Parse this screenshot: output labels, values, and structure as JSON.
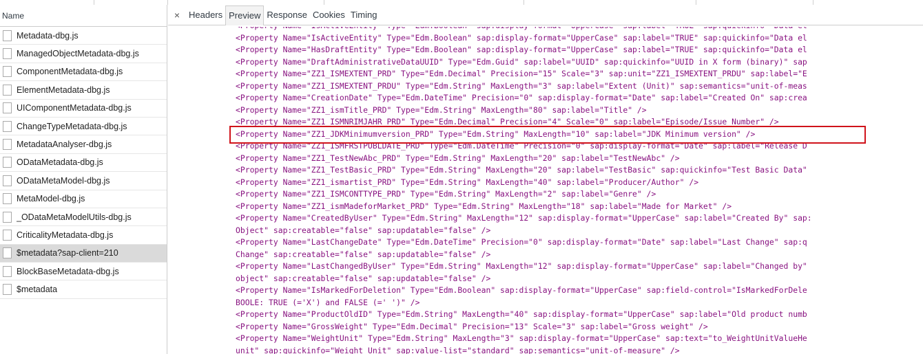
{
  "file_list": {
    "header": "Name",
    "items": [
      {
        "name": "Metadata-dbg.js",
        "selected": false
      },
      {
        "name": "ManagedObjectMetadata-dbg.js",
        "selected": false
      },
      {
        "name": "ComponentMetadata-dbg.js",
        "selected": false
      },
      {
        "name": "ElementMetadata-dbg.js",
        "selected": false
      },
      {
        "name": "UIComponentMetadata-dbg.js",
        "selected": false
      },
      {
        "name": "ChangeTypeMetadata-dbg.js",
        "selected": false
      },
      {
        "name": "MetadataAnalyser-dbg.js",
        "selected": false
      },
      {
        "name": "ODataMetadata-dbg.js",
        "selected": false
      },
      {
        "name": "ODataMetaModel-dbg.js",
        "selected": false
      },
      {
        "name": "MetaModel-dbg.js",
        "selected": false
      },
      {
        "name": "_ODataMetaModelUtils-dbg.js",
        "selected": false
      },
      {
        "name": "CriticalityMetadata-dbg.js",
        "selected": false
      },
      {
        "name": "$metadata?sap-client=210",
        "selected": true
      },
      {
        "name": "BlockBaseMetadata-dbg.js",
        "selected": false
      },
      {
        "name": "$metadata",
        "selected": false
      }
    ]
  },
  "detail_tabs": {
    "close_symbol": "×",
    "tabs": [
      {
        "label": "Headers",
        "active": false
      },
      {
        "label": "Preview",
        "active": true
      },
      {
        "label": "Response",
        "active": false
      },
      {
        "label": "Cookies",
        "active": false
      },
      {
        "label": "Timing",
        "active": false
      }
    ]
  },
  "preview": {
    "highlighted_line_index": 9,
    "lines": [
      "<Property Name=\"IsActiveEntity\" Type=\"Edm.Boolean\" sap:display-format=\"UpperCase\" sap:label=\"TRUE\" sap:quickinfo=\"Data el",
      "<Property Name=\"IsActiveEntity\" Type=\"Edm.Boolean\" sap:display-format=\"UpperCase\" sap:label=\"TRUE\" sap:quickinfo=\"Data el",
      "<Property Name=\"HasDraftEntity\" Type=\"Edm.Boolean\" sap:display-format=\"UpperCase\" sap:label=\"TRUE\" sap:quickinfo=\"Data el",
      "<Property Name=\"DraftAdministrativeDataUUID\" Type=\"Edm.Guid\" sap:label=\"UUID\" sap:quickinfo=\"UUID in X form (binary)\" sap",
      "<Property Name=\"ZZ1_ISMEXTENT_PRD\" Type=\"Edm.Decimal\" Precision=\"15\" Scale=\"3\" sap:unit=\"ZZ1_ISMEXTENT_PRDU\" sap:label=\"E",
      "<Property Name=\"ZZ1_ISMEXTENT_PRDU\" Type=\"Edm.String\" MaxLength=\"3\" sap:label=\"Extent (Unit)\" sap:semantics=\"unit-of-meas",
      "<Property Name=\"CreationDate\" Type=\"Edm.DateTime\" Precision=\"0\" sap:display-format=\"Date\" sap:label=\"Created On\" sap:crea",
      "<Property Name=\"ZZ1_ismTitle_PRD\" Type=\"Edm.String\" MaxLength=\"80\" sap:label=\"Title\" />",
      "<Property Name=\"ZZ1_ISMNRIMJAHR_PRD\" Type=\"Edm.Decimal\" Precision=\"4\" Scale=\"0\" sap:label=\"Episode/Issue Number\" />",
      "<Property Name=\"ZZ1_JDKMinimumversion_PRD\" Type=\"Edm.String\" MaxLength=\"10\" sap:label=\"JDK Minimum version\" />",
      "<Property Name=\"ZZ1_ISMFRSTPUBLDATE_PRD\" Type=\"Edm.DateTime\" Precision=\"0\" sap:display-format=\"Date\" sap:label=\"Release D",
      "<Property Name=\"ZZ1_TestNewAbc_PRD\" Type=\"Edm.String\" MaxLength=\"20\" sap:label=\"TestNewAbc\" />",
      "<Property Name=\"ZZ1_TestBasic_PRD\" Type=\"Edm.String\" MaxLength=\"20\" sap:label=\"TestBasic\" sap:quickinfo=\"Test Basic Data\"",
      "<Property Name=\"ZZ1_ismartist_PRD\" Type=\"Edm.String\" MaxLength=\"40\" sap:label=\"Producer/Author\" />",
      "<Property Name=\"ZZ1_ISMCONTTYPE_PRD\" Type=\"Edm.String\" MaxLength=\"2\" sap:label=\"Genre\" />",
      "<Property Name=\"ZZ1_ismMadeforMarket_PRD\" Type=\"Edm.String\" MaxLength=\"18\" sap:label=\"Made for Market\" />",
      "<Property Name=\"CreatedByUser\" Type=\"Edm.String\" MaxLength=\"12\" sap:display-format=\"UpperCase\" sap:label=\"Created By\" sap:",
      "Object\" sap:creatable=\"false\" sap:updatable=\"false\" />",
      "<Property Name=\"LastChangeDate\" Type=\"Edm.DateTime\" Precision=\"0\" sap:display-format=\"Date\" sap:label=\"Last Change\" sap:q",
      "Change\" sap:creatable=\"false\" sap:updatable=\"false\" />",
      "<Property Name=\"LastChangedByUser\" Type=\"Edm.String\" MaxLength=\"12\" sap:display-format=\"UpperCase\" sap:label=\"Changed by\"",
      "object\" sap:creatable=\"false\" sap:updatable=\"false\" />",
      "<Property Name=\"IsMarkedForDeletion\" Type=\"Edm.Boolean\" sap:display-format=\"UpperCase\" sap:field-control=\"IsMarkedForDele",
      "BOOLE: TRUE (='X') and FALSE (=' ')\" />",
      "<Property Name=\"ProductOldID\" Type=\"Edm.String\" MaxLength=\"40\" sap:display-format=\"UpperCase\" sap:label=\"Old product numb",
      "<Property Name=\"GrossWeight\" Type=\"Edm.Decimal\" Precision=\"13\" Scale=\"3\" sap:label=\"Gross weight\" />",
      "<Property Name=\"WeightUnit\" Type=\"Edm.String\" MaxLength=\"3\" sap:display-format=\"UpperCase\" sap:text=\"to_WeightUnitValueHe",
      "unit\" sap:quickinfo=\"Weight Unit\" sap:value-list=\"standard\" sap:semantics=\"unit-of-measure\" />"
    ]
  }
}
